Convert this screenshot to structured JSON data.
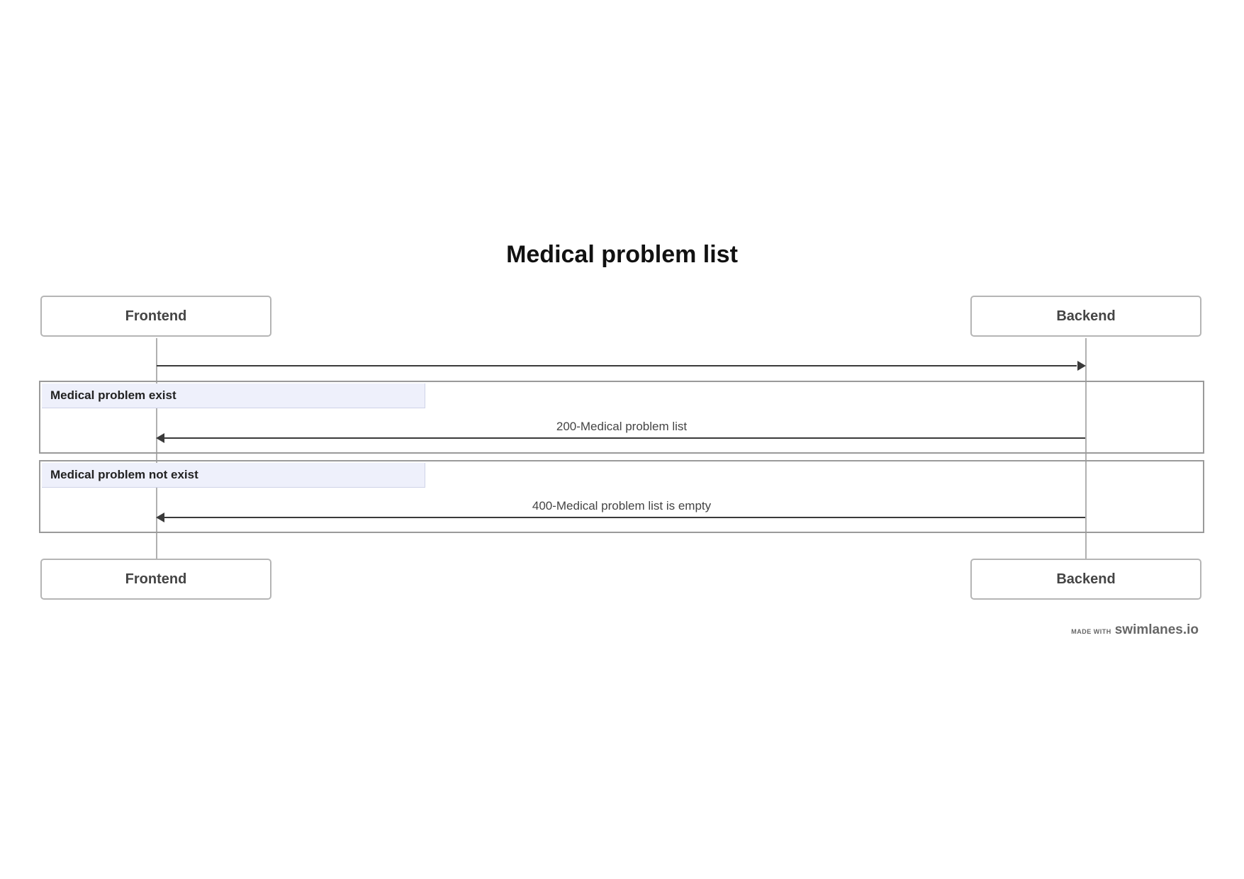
{
  "diagram": {
    "title": "Medical problem list",
    "participants": [
      {
        "id": "frontend",
        "label": "Frontend"
      },
      {
        "id": "backend",
        "label": "Backend"
      }
    ],
    "messages": [
      {
        "from": "frontend",
        "to": "backend",
        "label": ""
      }
    ],
    "groups": [
      {
        "label": "Medical problem exist",
        "messages": [
          {
            "from": "backend",
            "to": "frontend",
            "label": "200-Medical problem list"
          }
        ]
      },
      {
        "label": "Medical problem not exist",
        "messages": [
          {
            "from": "backend",
            "to": "frontend",
            "label": "400-Medical problem list is empty"
          }
        ]
      }
    ]
  },
  "footer": {
    "made_with": "MADE WITH",
    "brand": "swimlanes.io"
  }
}
